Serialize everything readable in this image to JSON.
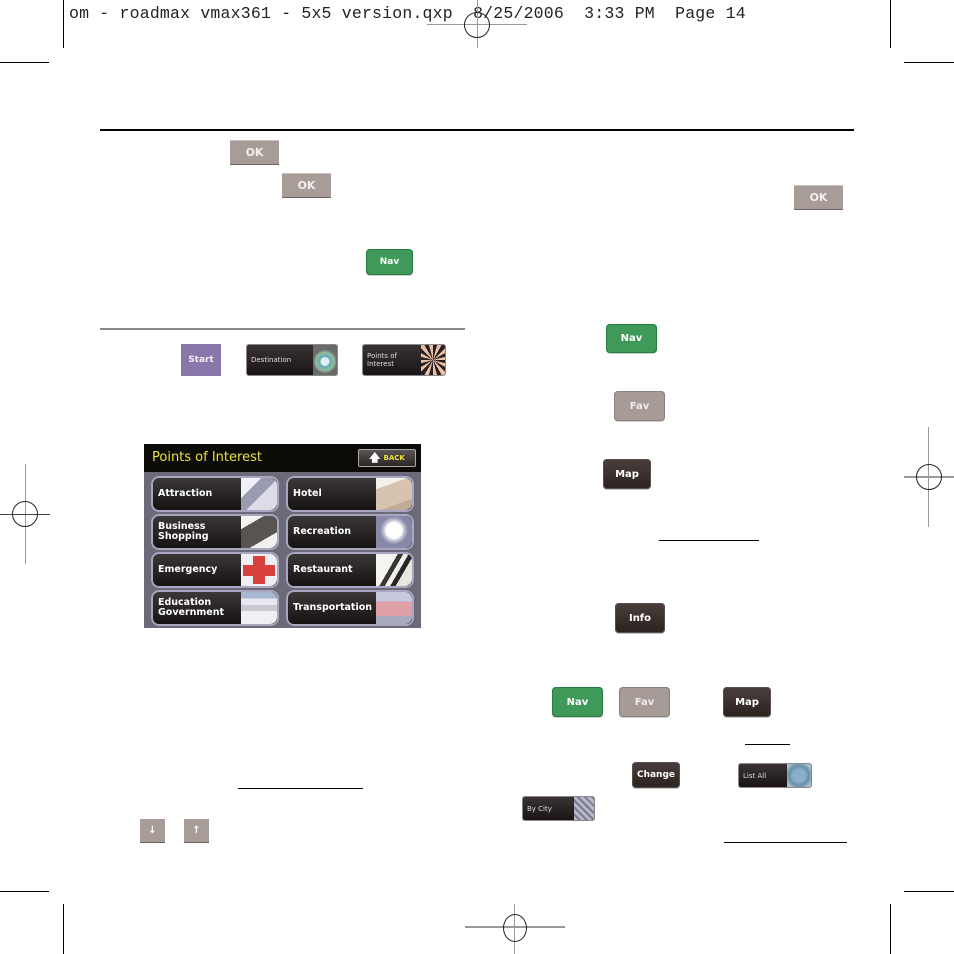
{
  "slug": {
    "text": "om - roadmax vmax361 - 5x5 version.qxp  8/25/2006  3:33 PM  Page 14"
  },
  "left_column": {
    "ok_button_1": "OK",
    "ok_button_2": "OK",
    "nav_button": "Nav",
    "start_button": "Start",
    "destination_button": "Destination",
    "poi_button": "Points of Interest",
    "arrow_down": "↓",
    "arrow_up": "↑"
  },
  "poi_screen": {
    "title": "Points of Interest",
    "back_label": "BACK",
    "categories": [
      {
        "label": "Attraction",
        "icon": "camera-icon"
      },
      {
        "label": "Hotel",
        "icon": "bed-icon"
      },
      {
        "label": "Business Shopping",
        "icon": "briefcase-icon"
      },
      {
        "label": "Recreation",
        "icon": "golf-ball-icon"
      },
      {
        "label": "Emergency",
        "icon": "red-cross-icon"
      },
      {
        "label": "Restaurant",
        "icon": "fork-knife-icon"
      },
      {
        "label": "Education Government",
        "icon": "capitol-building-icon"
      },
      {
        "label": "Transportation",
        "icon": "car-icon"
      }
    ]
  },
  "right_column": {
    "ok_button": "OK",
    "nav_button": "Nav",
    "fav_button": "Fav",
    "map_button": "Map",
    "info_button": "Info",
    "row_nav": "Nav",
    "row_fav": "Fav",
    "row_map": "Map",
    "change_button": "Change",
    "list_all_button": "List All",
    "by_city_button": "By City"
  },
  "colors": {
    "nav_green": "#3f9a5a",
    "fav_grey": "#a79b98",
    "ok_grey": "#a89c98",
    "dark_button": "#2a2220",
    "start_purple": "#8877a8",
    "poi_title_yellow": "#e8e23a"
  }
}
